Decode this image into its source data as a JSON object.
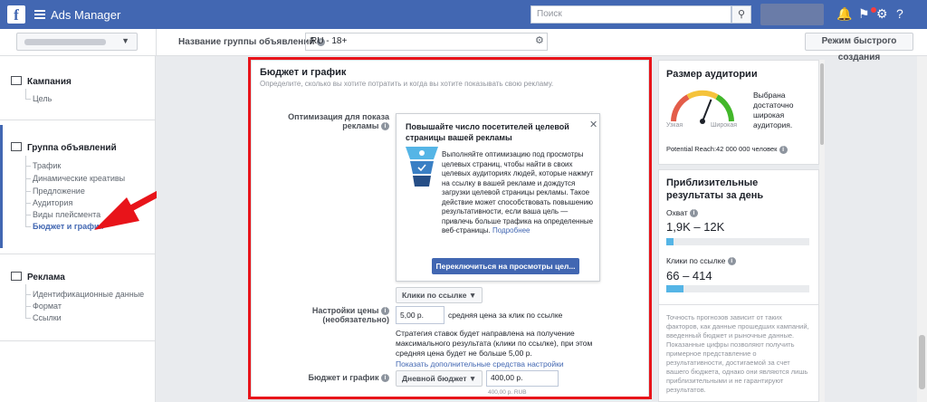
{
  "topbar": {
    "logo_letter": "f",
    "app_title": "Ads Manager",
    "search_placeholder": "Поиск"
  },
  "subbar": {
    "adset_name_label": "Название группы объявлений",
    "adset_name_value": "RU - 18+",
    "quick_create_label": "Режим быстрого создания"
  },
  "sidebar": {
    "campaign": {
      "label": "Кампания",
      "items": [
        "Цель"
      ]
    },
    "adset": {
      "label": "Группа объявлений",
      "items": [
        "Трафик",
        "Динамические креативы",
        "Предложение",
        "Аудитория",
        "Виды плейсмента",
        "Бюджет и график"
      ],
      "active_index": 5
    },
    "ad": {
      "label": "Реклама",
      "items": [
        "Идентификационные данные",
        "Формат",
        "Ссылки"
      ]
    }
  },
  "budget": {
    "title": "Бюджет и график",
    "subtitle": "Определите, сколько вы хотите потратить и когда вы хотите показывать свою рекламу.",
    "optimization_label_1": "Оптимизация для показа",
    "optimization_label_2": "рекламы",
    "popup": {
      "title": "Повышайте число посетителей целевой страницы вашей рекламы",
      "body": "Выполняйте оптимизацию под просмотры целевых страниц, чтобы найти в своих целевых аудиториях людей, которые нажмут на ссылку в вашей рекламе и дождутся загрузки целевой страницы рекламы. Такое действие может способствовать повышению результативности, если ваша цель — привлечь больше трафика на определенные веб-страницы.",
      "more_link": "Подробнее",
      "button": "Переключиться на просмотры цел..."
    },
    "optimization_value": "Клики по ссылке",
    "price_label_1": "Настройки цены",
    "price_label_2": "(необязательно)",
    "price_value": "5,00 р.",
    "price_desc": "средняя цена за клик по ссылке",
    "strategy_text": "Стратегия ставок будет направлена на получение максимального результата (клики по ссылке), при этом средняя цена будет не больше 5,00 р.",
    "more_settings_link": "Показать дополнительные средства настройки",
    "schedule_label": "Бюджет и график",
    "budget_type": "Дневной бюджет",
    "budget_value": "400,00 р.",
    "budget_hint": "400,00 р. RUB"
  },
  "audience": {
    "title": "Размер аудитории",
    "narrow": "Узкая",
    "wide": "Широкая",
    "verdict": "Выбрана достаточно широкая аудитория.",
    "reach": "Potential Reach:42 000 000 человек",
    "gauge_level": 0.62
  },
  "results": {
    "title": "Приблизительные результаты за день",
    "reach_label": "Охват",
    "reach_value": "1,9K – 12K",
    "reach_fill": 0.05,
    "clicks_label": "Клики по ссылке",
    "clicks_value": "66 – 414",
    "clicks_fill": 0.12,
    "disclaimer": "Точность прогнозов зависит от таких факторов, как данные прошедших кампаний, введенный бюджет и рыночные данные. Показанные цифры позволяют получить примерное представление о результативности, достигаемой за счет вашего бюджета, однако они являются лишь приблизительными и не гарантируют результатов."
  },
  "colors": {
    "brand": "#4267b2",
    "highlight": "#e8141a",
    "arrow": "#e8141a",
    "bar": "#55b5e6"
  },
  "icons": [
    "facebook-logo-icon",
    "hamburger-menu-icon",
    "search-icon",
    "bell-icon",
    "flag-icon",
    "gear-icon",
    "info-icon",
    "close-icon",
    "funnel-icon",
    "chevron-down-icon",
    "annotation-arrow-icon"
  ]
}
